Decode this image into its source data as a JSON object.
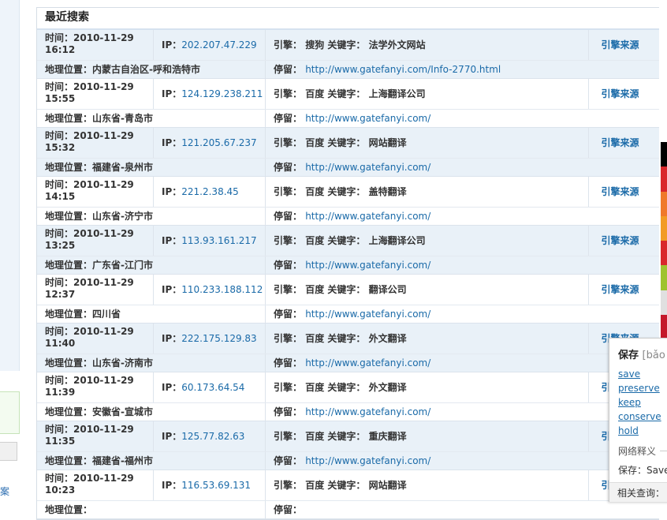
{
  "left": {
    "cutoff_text": "案"
  },
  "panel": {
    "title": "最近搜索",
    "labels": {
      "time": "时间：",
      "ip": "IP：",
      "engine": "引擎：",
      "keyword": "关键字：",
      "location": "地理位置：",
      "stay": "停留："
    },
    "source_label": "引擎来源",
    "records": [
      {
        "date": "2010-11-29",
        "clock": "16:12",
        "ip": "202.207.47.229",
        "engine": "搜狗",
        "keyword": "法学外文网站",
        "location": "内蒙古自治区-呼和浩特市",
        "stay": "http://www.gatefanyi.com/Info-2770.html",
        "alt": true
      },
      {
        "date": "2010-11-29",
        "clock": "15:55",
        "ip": "124.129.238.211",
        "engine": "百度",
        "keyword": "上海翻译公司",
        "location": "山东省-青岛市",
        "stay": "http://www.gatefanyi.com/",
        "alt": false
      },
      {
        "date": "2010-11-29",
        "clock": "15:32",
        "ip": "121.205.67.237",
        "engine": "百度",
        "keyword": "网站翻译",
        "location": "福建省-泉州市",
        "stay": "http://www.gatefanyi.com/",
        "alt": true
      },
      {
        "date": "2010-11-29",
        "clock": "14:15",
        "ip": "221.2.38.45",
        "engine": "百度",
        "keyword": "盖特翻译",
        "location": "山东省-济宁市",
        "stay": "http://www.gatefanyi.com/",
        "alt": false
      },
      {
        "date": "2010-11-29",
        "clock": "13:25",
        "ip": "113.93.161.217",
        "engine": "百度",
        "keyword": "上海翻译公司",
        "location": "广东省-江门市",
        "stay": "http://www.gatefanyi.com/",
        "alt": true
      },
      {
        "date": "2010-11-29",
        "clock": "12:37",
        "ip": "110.233.188.112",
        "engine": "百度",
        "keyword": "翻译公司",
        "location": "四川省",
        "stay": "http://www.gatefanyi.com/",
        "alt": false
      },
      {
        "date": "2010-11-29",
        "clock": "11:40",
        "ip": "222.175.129.83",
        "engine": "百度",
        "keyword": "外文翻译",
        "location": "山东省-济南市",
        "stay": "http://www.gatefanyi.com/",
        "alt": true
      },
      {
        "date": "2010-11-29",
        "clock": "11:39",
        "ip": "60.173.64.54",
        "engine": "百度",
        "keyword": "外文翻译",
        "location": "安徽省-宣城市",
        "stay": "http://www.gatefanyi.com/",
        "alt": false
      },
      {
        "date": "2010-11-29",
        "clock": "11:35",
        "ip": "125.77.82.63",
        "engine": "百度",
        "keyword": "重庆翻译",
        "location": "福建省-福州市",
        "stay": "http://www.gatefanyi.com/",
        "alt": true
      },
      {
        "date": "2010-11-29",
        "clock": "10:23",
        "ip": "116.53.69.131",
        "engine": "百度",
        "keyword": "网站翻译",
        "location": "",
        "stay": "",
        "alt": false
      }
    ]
  },
  "colorstrip": [
    "#000000",
    "#d9262b",
    "#f0792a",
    "#f29b24",
    "#d9262b",
    "#9fc32e",
    "#e0e0e0",
    "#c4182a"
  ],
  "popup": {
    "word": "保存",
    "pinyin": "[bǎo",
    "translations": [
      "save",
      "preserve",
      "keep",
      "conserve",
      "hold"
    ],
    "net_label": "网络释义",
    "save_line": "保存：Save",
    "related": "相关查询："
  }
}
